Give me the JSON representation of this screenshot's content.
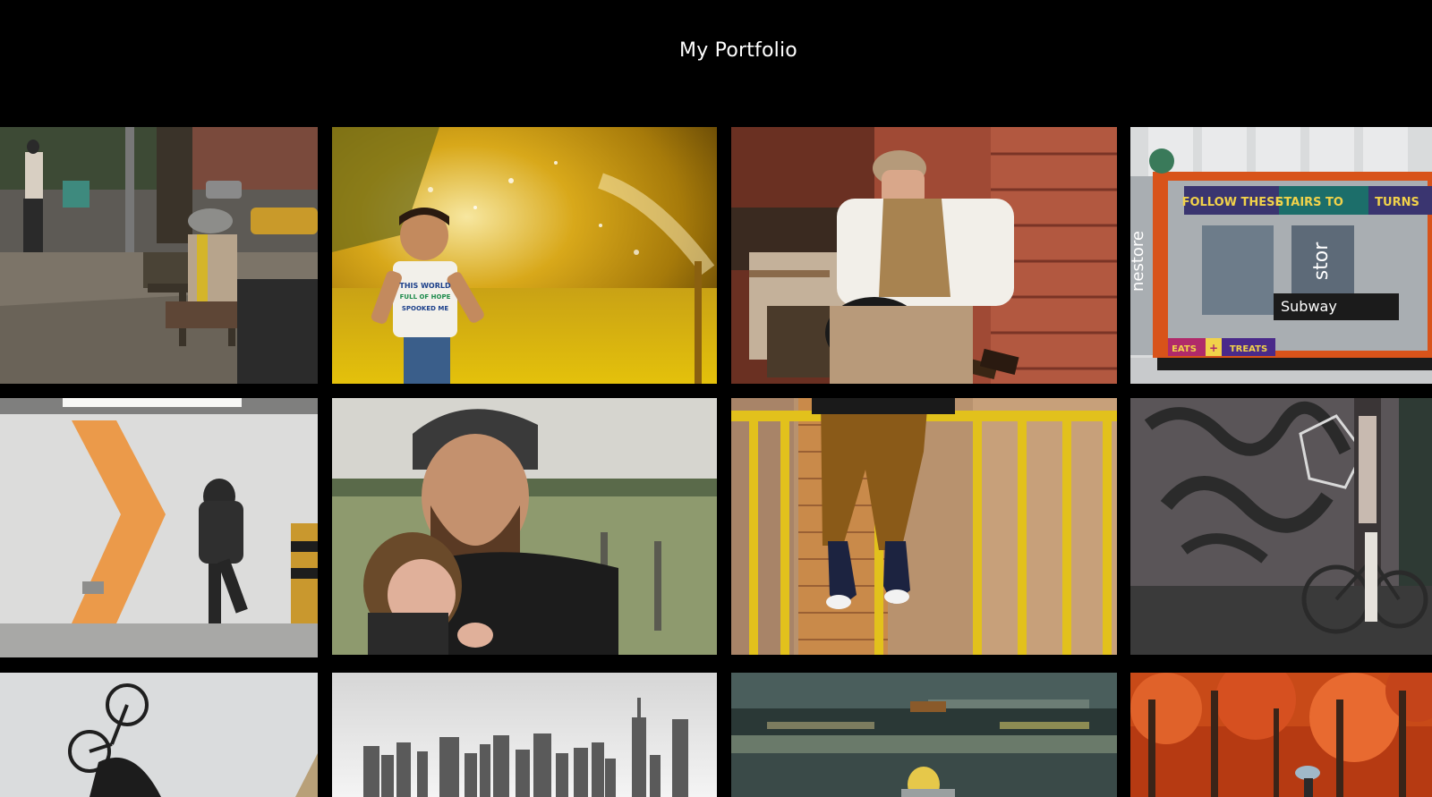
{
  "page": {
    "title": "My Portfolio",
    "background": "#000000"
  },
  "gallery": {
    "rows": [
      [
        "street-bench",
        "sprinkler-boy",
        "guitar-player",
        "subway-entrance"
      ],
      [
        "chevron-hallway",
        "father-daughter",
        "sneakers-railing",
        "graffiti-bicycle"
      ],
      [
        "bmx-jump",
        "city-skyline",
        "motion-blur-street",
        "autumn-park"
      ]
    ],
    "subway_sign": {
      "lines": [
        "FOLLOW THESE",
        "STAIRS TO",
        "TURNS"
      ],
      "label": "Subway",
      "bottom": [
        "EATS",
        "+",
        "TREATS"
      ],
      "side_text": [
        "nestore",
        "stor"
      ]
    },
    "shirt_text": [
      "THIS WORLD",
      "FULL OF HOPE",
      "SPOOKED ME"
    ]
  }
}
